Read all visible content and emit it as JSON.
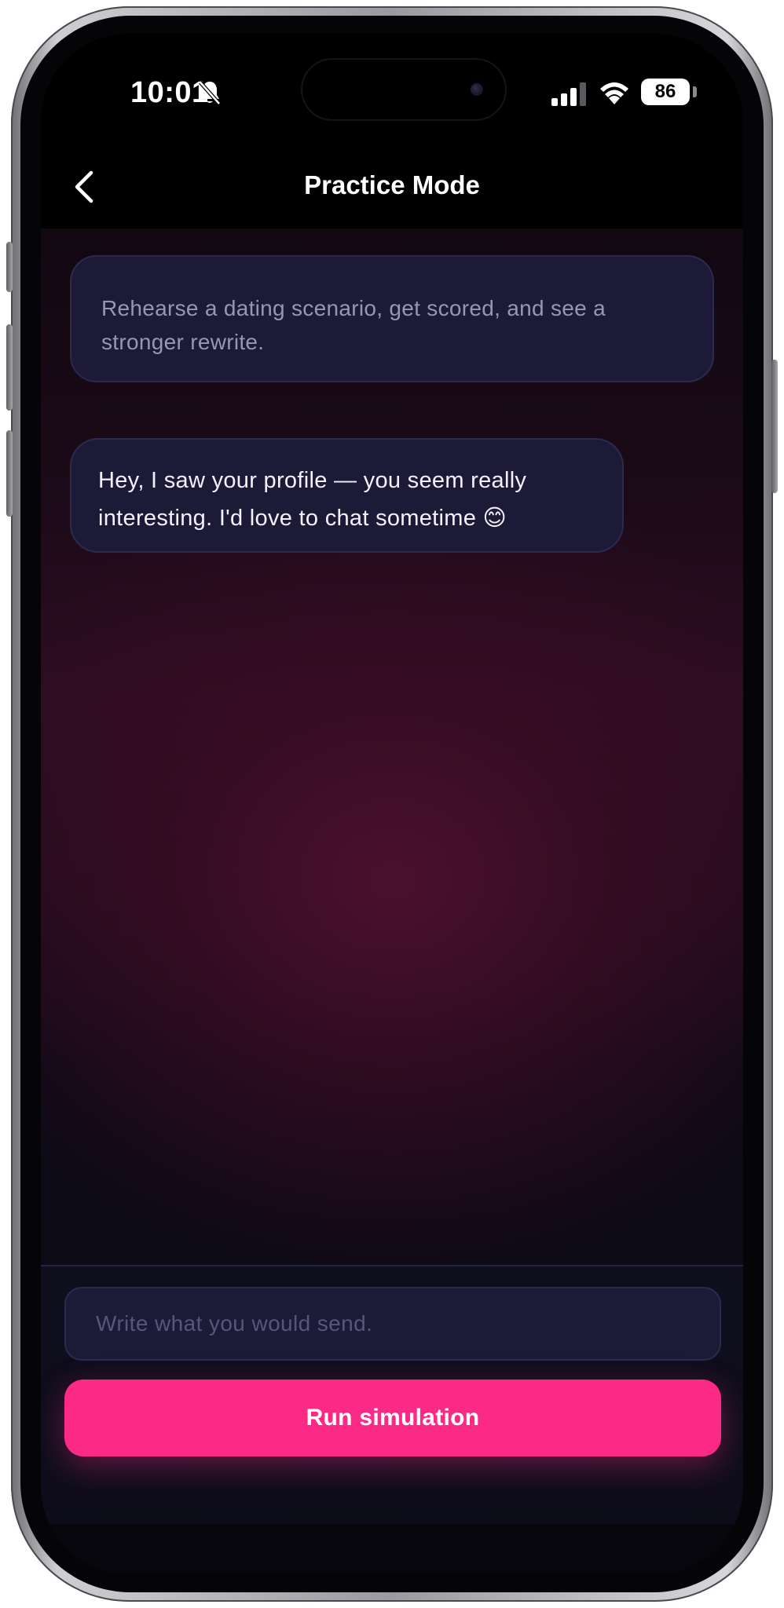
{
  "status_bar": {
    "time": "10:01",
    "battery": "86",
    "icons": [
      "bell-slash-icon",
      "cellular-signal-icon",
      "wifi-icon",
      "battery-icon"
    ]
  },
  "nav": {
    "title": "Practice Mode",
    "back_icon": "chevron-left-icon"
  },
  "intro": {
    "text": "Rehearse a dating scenario, get scored, and see a stronger rewrite."
  },
  "message": {
    "text": "Hey, I saw your profile — you seem really interesting. I'd love to chat sometime 😊"
  },
  "composer": {
    "value": "",
    "placeholder": "Write what you would send.",
    "button_label": "Run simulation"
  },
  "colors": {
    "accent": "#fb2a87",
    "card": "#1c1a37",
    "background": "#000000"
  }
}
